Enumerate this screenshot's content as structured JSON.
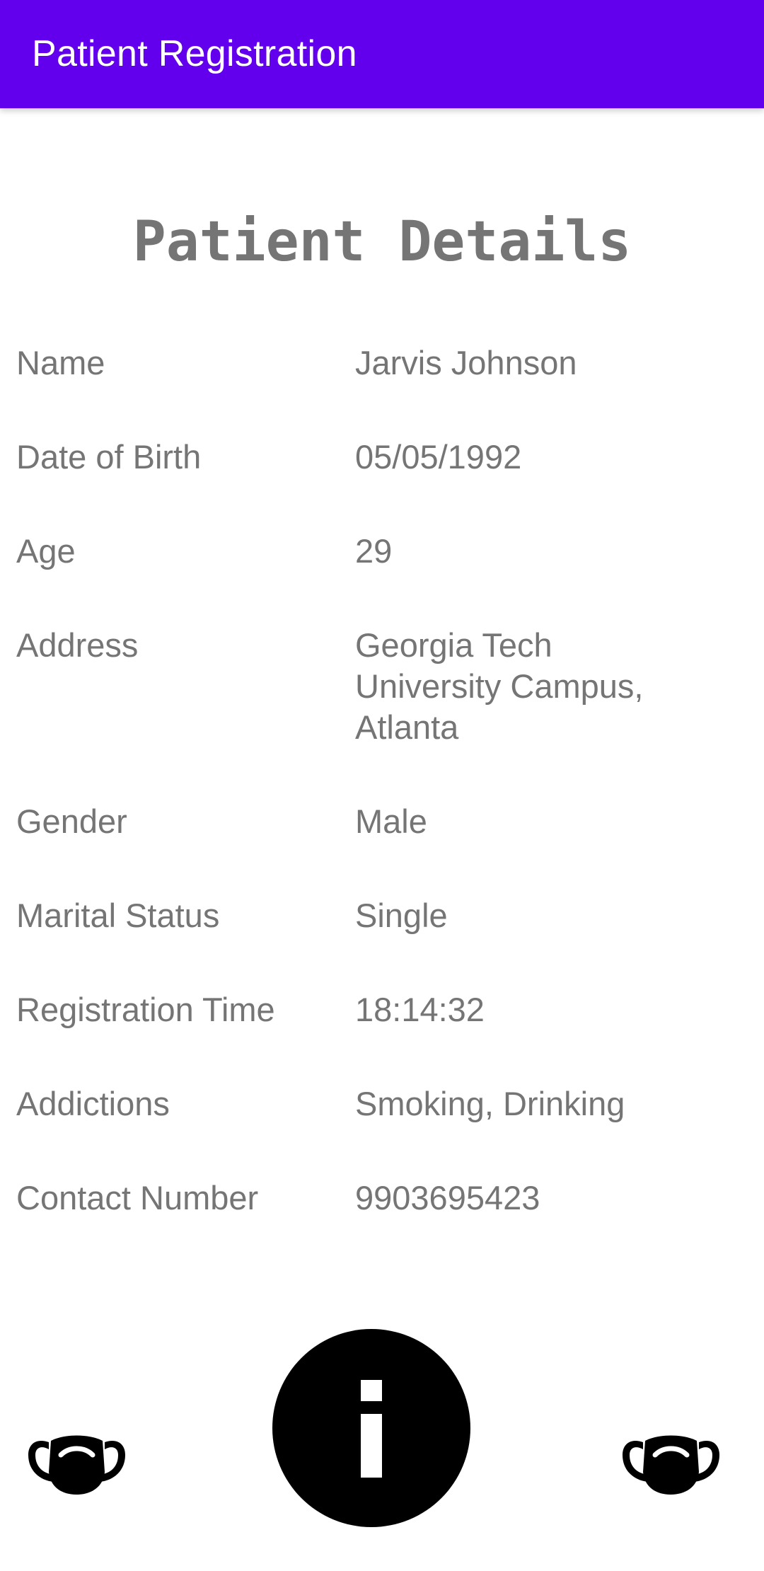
{
  "appbar": {
    "title": "Patient Registration",
    "background": "#6200EE"
  },
  "page_title": "Patient Details",
  "details": [
    {
      "label": "Name",
      "value": "Jarvis Johnson"
    },
    {
      "label": "Date of Birth",
      "value": "05/05/1992"
    },
    {
      "label": "Age",
      "value": "29"
    },
    {
      "label": "Address",
      "value": "Georgia Tech University Campus, Atlanta"
    },
    {
      "label": "Gender",
      "value": "Male"
    },
    {
      "label": "Marital Status",
      "value": "Single"
    },
    {
      "label": "Registration Time",
      "value": "18:14:32"
    },
    {
      "label": "Addictions",
      "value": "Smoking, Drinking"
    },
    {
      "label": "Contact Number",
      "value": "9903695423"
    }
  ],
  "bottom_bar": {
    "left_icon": "face-mask-icon",
    "center_icon": "info-icon",
    "right_icon": "face-mask-icon"
  }
}
